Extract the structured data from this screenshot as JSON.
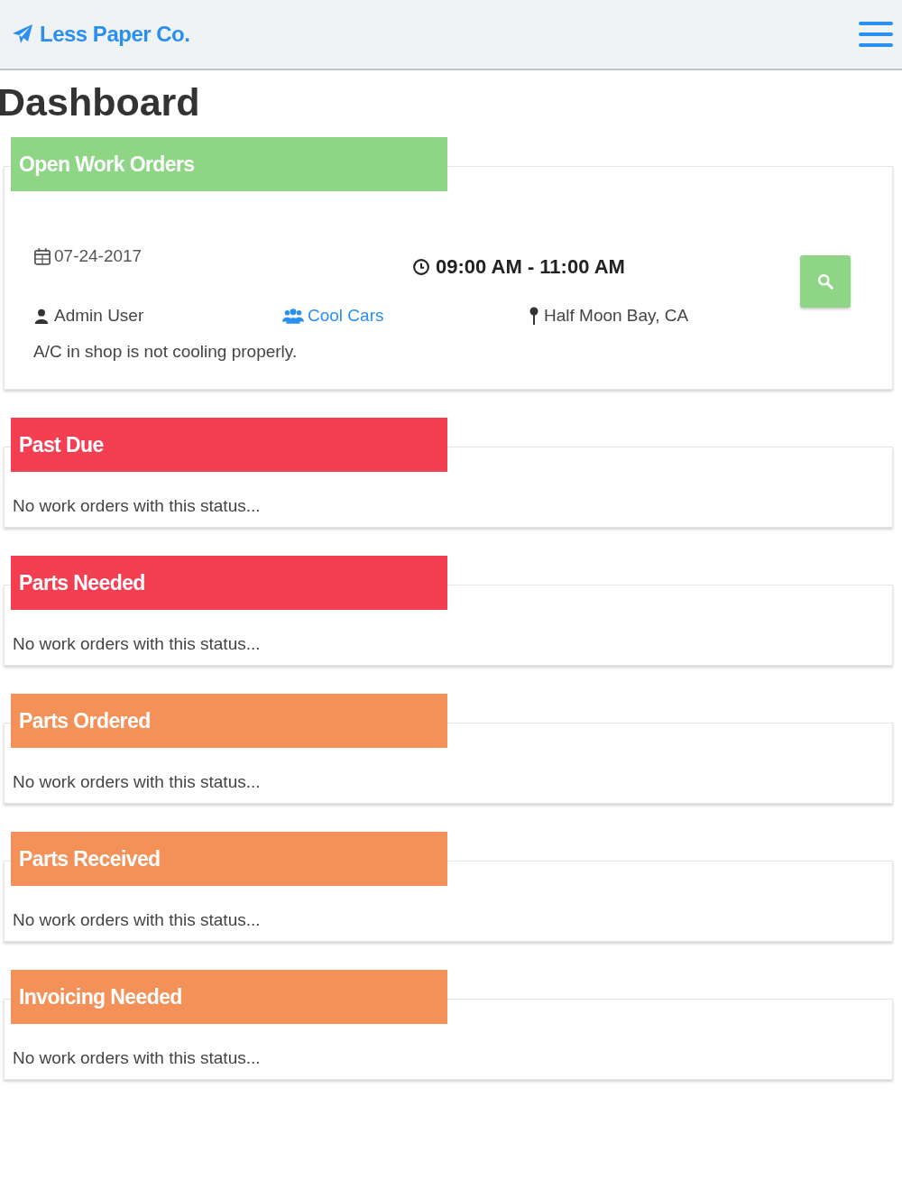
{
  "navbar": {
    "brand": "Less Paper Co."
  },
  "page_title": "Dashboard",
  "sections": [
    {
      "title": "Open Work Orders",
      "color": "#8ed686",
      "work_orders": [
        {
          "date": "07-24-2017",
          "time": "09:00 AM - 11:00 AM",
          "user": "Admin User",
          "customer": "Cool Cars",
          "location": "Half Moon Bay, CA",
          "description": "A/C in shop is not cooling properly."
        }
      ]
    },
    {
      "title": "Past Due",
      "color": "#f43f53",
      "empty_message": "No work orders with this status..."
    },
    {
      "title": "Parts Needed",
      "color": "#f43f53",
      "empty_message": "No work orders with this status..."
    },
    {
      "title": "Parts Ordered",
      "color": "#f39158",
      "empty_message": "No work orders with this status..."
    },
    {
      "title": "Parts Received",
      "color": "#f39158",
      "empty_message": "No work orders with this status..."
    },
    {
      "title": "Invoicing Needed",
      "color": "#f39158",
      "empty_message": "No work orders with this status..."
    }
  ]
}
